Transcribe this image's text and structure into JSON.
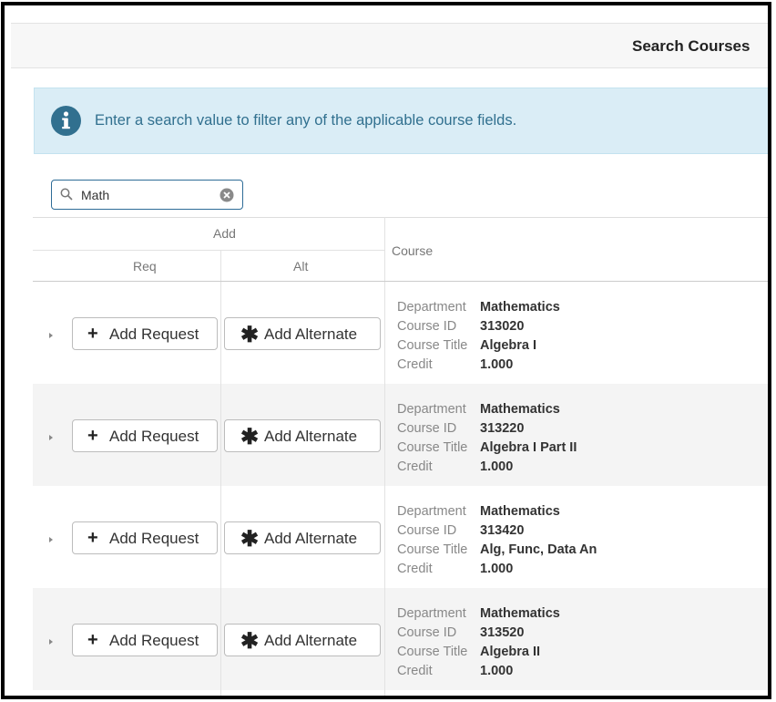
{
  "header": {
    "title": "Search Courses"
  },
  "alert": {
    "text": "Enter a search value to filter any of the applicable course fields."
  },
  "search": {
    "value": "Math",
    "placeholder": ""
  },
  "grid": {
    "group_header": "Add",
    "col_req": "Req",
    "col_alt": "Alt",
    "col_course": "Course"
  },
  "labels": {
    "add_request": "Add Request",
    "add_alternate": "Add Alternate",
    "department": "Department",
    "course_id": "Course ID",
    "course_title": "Course Title",
    "credit": "Credit"
  },
  "courses": [
    {
      "department": "Mathematics",
      "course_id": "313020",
      "course_title": "Algebra I",
      "credit": "1.000"
    },
    {
      "department": "Mathematics",
      "course_id": "313220",
      "course_title": "Algebra I Part II",
      "credit": "1.000"
    },
    {
      "department": "Mathematics",
      "course_id": "313420",
      "course_title": "Alg, Func, Data An",
      "credit": "1.000"
    },
    {
      "department": "Mathematics",
      "course_id": "313520",
      "course_title": "Algebra II",
      "credit": "1.000"
    }
  ],
  "colors": {
    "accent": "#31708f",
    "alert_bg": "#daedf6",
    "search_border": "#2e6c97"
  },
  "icons": {
    "info": "info-circle-icon",
    "search": "search-icon",
    "clear": "clear-circle-icon",
    "plus": "plus-icon",
    "asterisk": "asterisk-icon",
    "expander": "caret-right-icon"
  }
}
